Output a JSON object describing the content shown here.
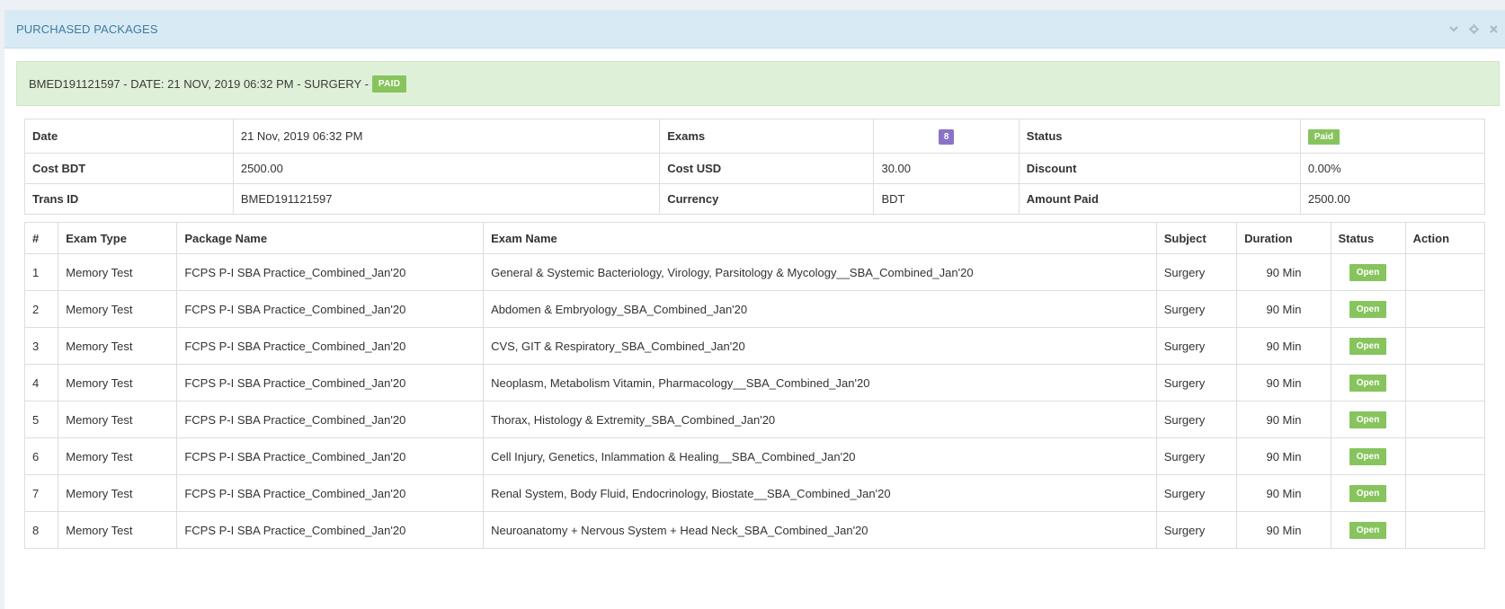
{
  "widget": {
    "title": "PURCHASED PACKAGES",
    "tools": [
      "chevron-down-icon",
      "gear-icon",
      "close-icon"
    ]
  },
  "alert": {
    "text": "BMED191121597 - DATE: 21 NOV, 2019 06:32 PM - SURGERY -",
    "badge": "PAID",
    "colors": {
      "background": "#dff0d8",
      "badge": "#87c45e"
    }
  },
  "info": {
    "row1": {
      "date_label": "Date",
      "date_value": "21 Nov, 2019 06:32 PM",
      "exams_label": "Exams",
      "exams_value": "8",
      "status_label": "Status",
      "status_value": "Paid"
    },
    "row2": {
      "cost_bdt_label": "Cost BDT",
      "cost_bdt_value": "2500.00",
      "cost_usd_label": "Cost USD",
      "cost_usd_value": "30.00",
      "discount_label": "Discount",
      "discount_value": "0.00%"
    },
    "row3": {
      "trans_label": "Trans ID",
      "trans_value": "BMED191121597",
      "currency_label": "Currency",
      "currency_value": "BDT",
      "amount_label": "Amount Paid",
      "amount_value": "2500.00"
    }
  },
  "exams": {
    "headers": [
      "#",
      "Exam Type",
      "Package Name",
      "Exam Name",
      "Subject",
      "Duration",
      "Status",
      "Action"
    ],
    "rows": [
      {
        "num": "1",
        "type": "Memory Test",
        "package": "FCPS P-I SBA Practice_Combined_Jan'20",
        "name": "General & Systemic Bacteriology, Virology, Parsitology & Mycology__SBA_Combined_Jan'20",
        "subject": "Surgery",
        "duration": "90 Min",
        "status": "Open"
      },
      {
        "num": "2",
        "type": "Memory Test",
        "package": "FCPS P-I SBA Practice_Combined_Jan'20",
        "name": "Abdomen & Embryology_SBA_Combined_Jan'20",
        "subject": "Surgery",
        "duration": "90 Min",
        "status": "Open"
      },
      {
        "num": "3",
        "type": "Memory Test",
        "package": "FCPS P-I SBA Practice_Combined_Jan'20",
        "name": "CVS, GIT & Respiratory_SBA_Combined_Jan'20",
        "subject": "Surgery",
        "duration": "90 Min",
        "status": "Open"
      },
      {
        "num": "4",
        "type": "Memory Test",
        "package": "FCPS P-I SBA Practice_Combined_Jan'20",
        "name": "Neoplasm, Metabolism Vitamin, Pharmacology__SBA_Combined_Jan'20",
        "subject": "Surgery",
        "duration": "90 Min",
        "status": "Open"
      },
      {
        "num": "5",
        "type": "Memory Test",
        "package": "FCPS P-I SBA Practice_Combined_Jan'20",
        "name": "Thorax, Histology & Extremity_SBA_Combined_Jan'20",
        "subject": "Surgery",
        "duration": "90 Min",
        "status": "Open"
      },
      {
        "num": "6",
        "type": "Memory Test",
        "package": "FCPS P-I SBA Practice_Combined_Jan'20",
        "name": "Cell Injury, Genetics, Inlammation & Healing__SBA_Combined_Jan'20",
        "subject": "Surgery",
        "duration": "90 Min",
        "status": "Open"
      },
      {
        "num": "7",
        "type": "Memory Test",
        "package": "FCPS P-I SBA Practice_Combined_Jan'20",
        "name": "Renal System, Body Fluid, Endocrinology, Biostate__SBA_Combined_Jan'20",
        "subject": "Surgery",
        "duration": "90 Min",
        "status": "Open"
      },
      {
        "num": "8",
        "type": "Memory Test",
        "package": "FCPS P-I SBA Practice_Combined_Jan'20",
        "name": "Neuroanatomy + Nervous System + Head Neck_SBA_Combined_Jan'20",
        "subject": "Surgery",
        "duration": "90 Min",
        "status": "Open"
      }
    ]
  }
}
